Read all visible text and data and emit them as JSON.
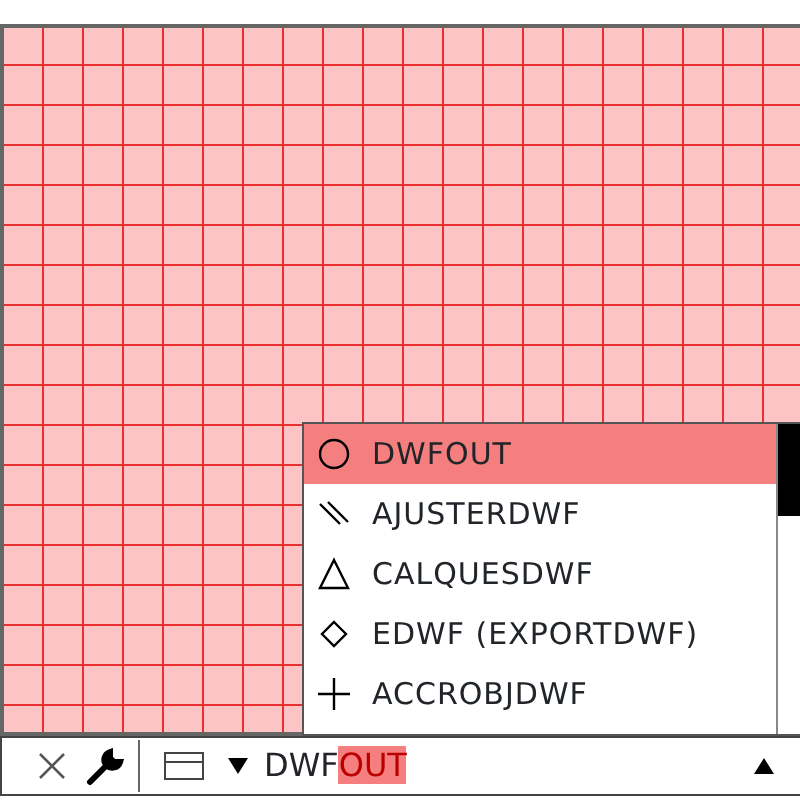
{
  "autocomplete": {
    "items": [
      {
        "kind": "circle",
        "label": "DWFOUT",
        "selected": true
      },
      {
        "kind": "lines",
        "label": "AJUSTERDWF",
        "selected": false
      },
      {
        "kind": "triangle",
        "label": "CALQUESDWF",
        "selected": false
      },
      {
        "kind": "diamond",
        "label": "EDWF (EXPORTDWF)",
        "selected": false
      },
      {
        "kind": "plus",
        "label": "ACCROBJDWF",
        "selected": false
      }
    ]
  },
  "command_line": {
    "typed": "DWF",
    "suggestion": "OUT"
  }
}
